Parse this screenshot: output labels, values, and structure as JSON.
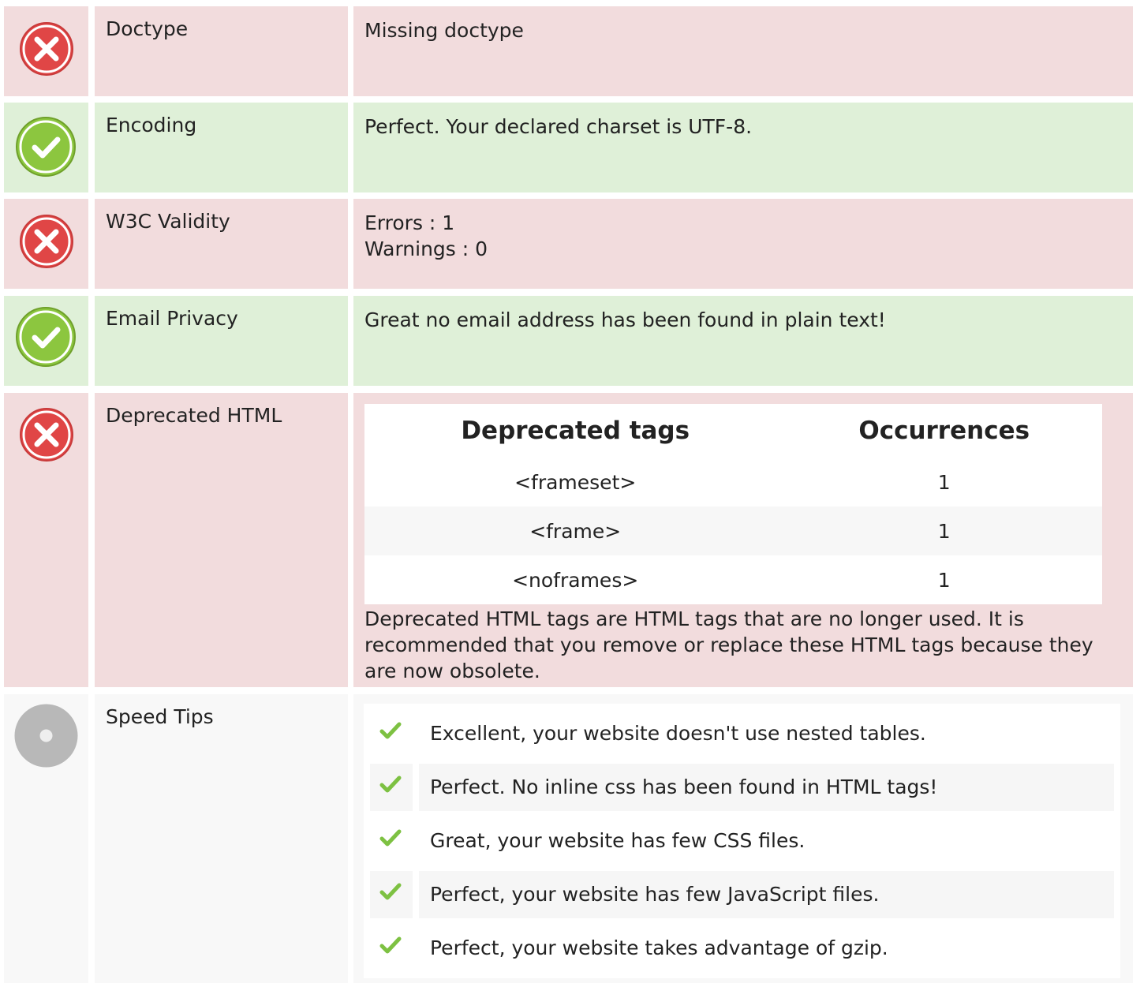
{
  "colors": {
    "bad_bg": "#f2dcdd",
    "good_bg": "#dff0d8",
    "neutral_bg": "#f8f8f8",
    "error_red": "#e04646",
    "success_green": "#8cc63f",
    "neutral_grey": "#b8b8b8"
  },
  "rows": {
    "doctype": {
      "status": "error-icon",
      "label": "Doctype",
      "value": "Missing doctype"
    },
    "encoding": {
      "status": "success-icon",
      "label": "Encoding",
      "value": "Perfect. Your declared charset is UTF-8."
    },
    "w3c": {
      "status": "error-icon",
      "label": "W3C Validity",
      "errors": "Errors : 1",
      "warnings": "Warnings : 0"
    },
    "email": {
      "status": "success-icon",
      "label": "Email Privacy",
      "value": "Great no email address has been found in plain text!"
    },
    "deprecated": {
      "status": "error-icon",
      "label": "Deprecated HTML",
      "headers": [
        "Deprecated tags",
        "Occurrences"
      ],
      "rows": [
        {
          "tag": "<frameset>",
          "count": "1"
        },
        {
          "tag": "<frame>",
          "count": "1"
        },
        {
          "tag": "<noframes>",
          "count": "1"
        }
      ],
      "note": "Deprecated HTML tags are HTML tags that are no longer used. It is recommended that you remove or replace these HTML tags because they are now obsolete."
    },
    "speed": {
      "status": "neutral-icon",
      "label": "Speed Tips",
      "tips": [
        "Excellent, your website doesn't use nested tables.",
        "Perfect. No inline css has been found in HTML tags!",
        "Great, your website has few CSS files.",
        "Perfect, your website has few JavaScript files.",
        "Perfect, your website takes advantage of gzip."
      ]
    }
  }
}
